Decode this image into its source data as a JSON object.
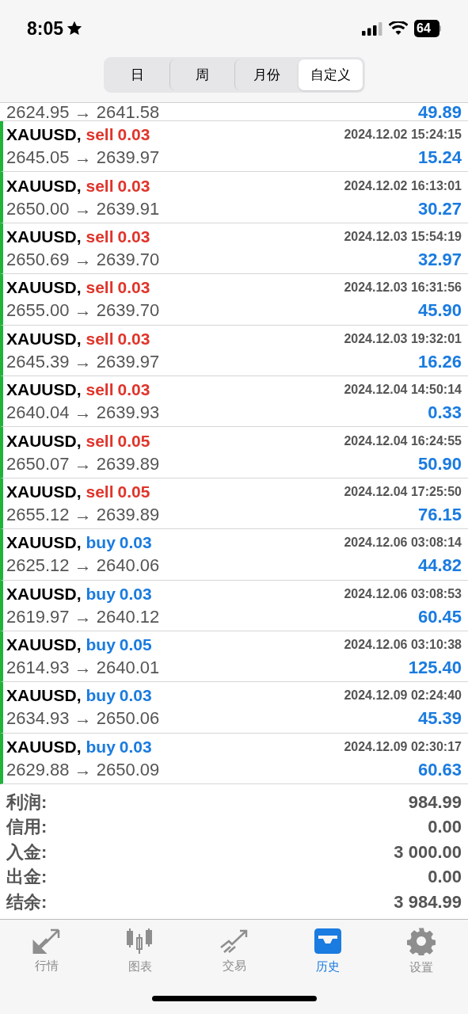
{
  "status_bar": {
    "time": "8:05",
    "battery": "64"
  },
  "segments": [
    {
      "label": "日",
      "selected": false
    },
    {
      "label": "周",
      "selected": false
    },
    {
      "label": "月份",
      "selected": false
    },
    {
      "label": "自定义",
      "selected": true
    }
  ],
  "partial_row": {
    "prices": "2624.95 → 2641.58",
    "profit": "49.89"
  },
  "deals": [
    {
      "symbol": "XAUUSD,",
      "side": "sell",
      "volume": "0.03",
      "time": "2024.12.02 15:24:15",
      "prices": "2645.05 → 2639.97",
      "profit": "15.24"
    },
    {
      "symbol": "XAUUSD,",
      "side": "sell",
      "volume": "0.03",
      "time": "2024.12.02 16:13:01",
      "prices": "2650.00 → 2639.91",
      "profit": "30.27"
    },
    {
      "symbol": "XAUUSD,",
      "side": "sell",
      "volume": "0.03",
      "time": "2024.12.03 15:54:19",
      "prices": "2650.69 → 2639.70",
      "profit": "32.97"
    },
    {
      "symbol": "XAUUSD,",
      "side": "sell",
      "volume": "0.03",
      "time": "2024.12.03 16:31:56",
      "prices": "2655.00 → 2639.70",
      "profit": "45.90"
    },
    {
      "symbol": "XAUUSD,",
      "side": "sell",
      "volume": "0.03",
      "time": "2024.12.03 19:32:01",
      "prices": "2645.39 → 2639.97",
      "profit": "16.26"
    },
    {
      "symbol": "XAUUSD,",
      "side": "sell",
      "volume": "0.03",
      "time": "2024.12.04 14:50:14",
      "prices": "2640.04 → 2639.93",
      "profit": "0.33"
    },
    {
      "symbol": "XAUUSD,",
      "side": "sell",
      "volume": "0.05",
      "time": "2024.12.04 16:24:55",
      "prices": "2650.07 → 2639.89",
      "profit": "50.90"
    },
    {
      "symbol": "XAUUSD,",
      "side": "sell",
      "volume": "0.05",
      "time": "2024.12.04 17:25:50",
      "prices": "2655.12 → 2639.89",
      "profit": "76.15"
    },
    {
      "symbol": "XAUUSD,",
      "side": "buy",
      "volume": "0.03",
      "time": "2024.12.06 03:08:14",
      "prices": "2625.12 → 2640.06",
      "profit": "44.82"
    },
    {
      "symbol": "XAUUSD,",
      "side": "buy",
      "volume": "0.03",
      "time": "2024.12.06 03:08:53",
      "prices": "2619.97 → 2640.12",
      "profit": "60.45"
    },
    {
      "symbol": "XAUUSD,",
      "side": "buy",
      "volume": "0.05",
      "time": "2024.12.06 03:10:38",
      "prices": "2614.93 → 2640.01",
      "profit": "125.40"
    },
    {
      "symbol": "XAUUSD,",
      "side": "buy",
      "volume": "0.03",
      "time": "2024.12.09 02:24:40",
      "prices": "2634.93 → 2650.06",
      "profit": "45.39"
    },
    {
      "symbol": "XAUUSD,",
      "side": "buy",
      "volume": "0.03",
      "time": "2024.12.09 02:30:17",
      "prices": "2629.88 → 2650.09",
      "profit": "60.63"
    }
  ],
  "summary": [
    {
      "label": "利润:",
      "value": "984.99"
    },
    {
      "label": "信用:",
      "value": "0.00"
    },
    {
      "label": "入金:",
      "value": "3 000.00"
    },
    {
      "label": "出金:",
      "value": "0.00"
    },
    {
      "label": "结余:",
      "value": "3 984.99"
    }
  ],
  "tab_bar": [
    {
      "kind": "quotes",
      "label": "行情",
      "selected": false
    },
    {
      "kind": "chart",
      "label": "图表",
      "selected": false
    },
    {
      "kind": "trade",
      "label": "交易",
      "selected": false
    },
    {
      "kind": "history",
      "label": "历史",
      "selected": true
    },
    {
      "kind": "settings",
      "label": "设置",
      "selected": false
    }
  ]
}
